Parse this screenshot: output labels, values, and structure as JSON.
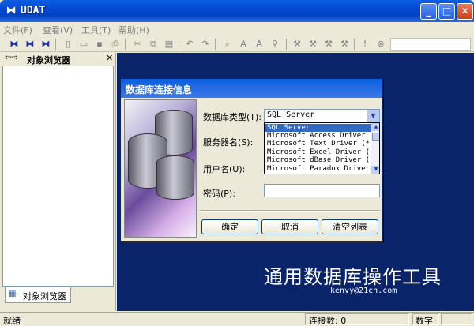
{
  "window": {
    "title": "UDAT",
    "min": "_",
    "max": "□",
    "close": "✕"
  },
  "menu": [
    "文件(F)",
    "查看(V)",
    "工具(T)",
    "帮助(H)"
  ],
  "left_panel": {
    "title": "对象浏览器",
    "nav_arrows": "⇦⇨",
    "close": "✕",
    "tab_label": "对象浏览器"
  },
  "dialog": {
    "title": "数据库连接信息",
    "labels": {
      "db_type": "数据库类型(T):",
      "server": "服务器名(S):",
      "user": "用户名(U):",
      "password": "密码(P):"
    },
    "db_type_value": "SQL Server",
    "dropdown_options": [
      "SQL Server",
      "Microsoft Access Driver",
      "Microsoft Text Driver (*",
      "Microsoft Excel Driver (",
      "Microsoft dBase Driver (",
      "Microsoft Paradox Driver"
    ],
    "buttons": {
      "ok": "确定",
      "cancel": "取消",
      "clear": "清空列表"
    }
  },
  "main": {
    "big_title": "通用数据库操作工具",
    "email": "kenvy@21cn.com"
  },
  "status": {
    "ready": "就绪",
    "connections": "连接数: 0",
    "numlock": "数字"
  },
  "colors": {
    "main_bg": "#0a246a",
    "title_blue": "#0449d3",
    "selection": "#316ac5"
  }
}
